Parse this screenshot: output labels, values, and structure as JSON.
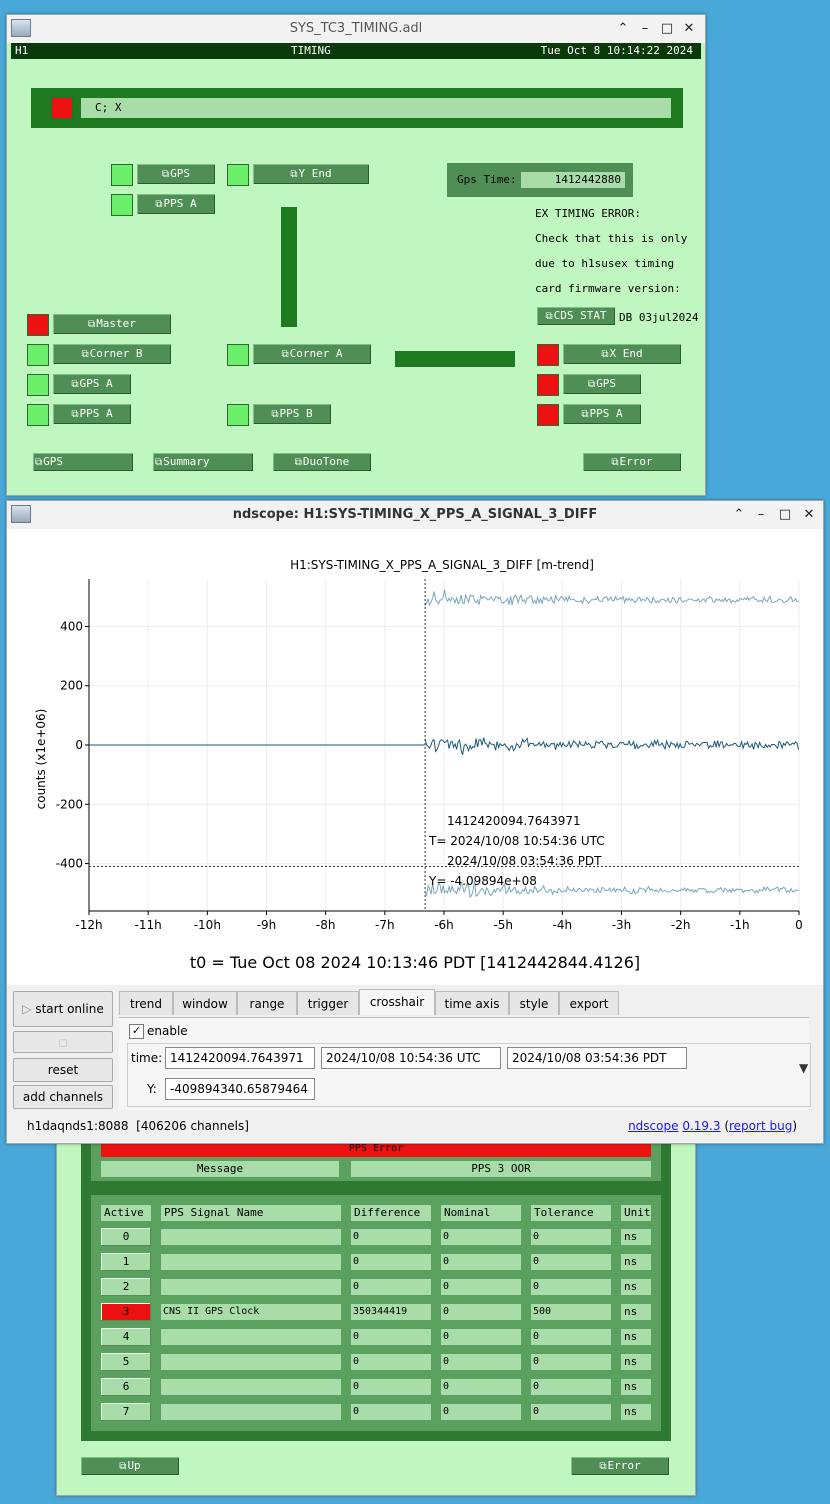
{
  "medm": {
    "window_title": "SYS_TC3_TIMING.adl",
    "header": {
      "site": "H1",
      "title": "TIMING",
      "datetime": "Tue Oct  8 10:14:22 2024"
    },
    "status_text": "C; X",
    "buttons": {
      "gps_top": "GPS",
      "pps_a_top": "PPS A",
      "y_end": "Y End",
      "master": "Master",
      "corner_b": "Corner B",
      "gps_a": "GPS A",
      "pps_a_left": "PPS A",
      "corner_a": "Corner A",
      "pps_b": "PPS B",
      "x_end": "X End",
      "gps_right": "GPS",
      "pps_a_right": "PPS A",
      "cds_stat": "CDS STAT",
      "gps_bottom": "GPS",
      "summary": "Summary",
      "duotone": "DuoTone",
      "error": "Error"
    },
    "gps_time_label": "Gps Time:",
    "gps_time_value": "1412442880",
    "message_lines": [
      "EX TIMING ERROR:",
      "Check that this is only",
      "due to h1susex timing",
      "card firmware version:"
    ],
    "db_label": "DB 03jul2024"
  },
  "ndscope": {
    "window_title": "ndscope: H1:SYS-TIMING_X_PPS_A_SIGNAL_3_DIFF",
    "plot_title": "H1:SYS-TIMING_X_PPS_A_SIGNAL_3_DIFF [m-trend]",
    "t0_label": "t0 = Tue Oct 08 2024 10:13:46 PDT [1412442844.4126]",
    "buttons": {
      "start_online": "start online",
      "reset": "reset",
      "add_channels": "add channels"
    },
    "tabs": [
      "trend",
      "window",
      "range",
      "trigger",
      "crosshair",
      "time axis",
      "style",
      "export"
    ],
    "selected_tab": "crosshair",
    "crosshair": {
      "enable_label": "enable",
      "enabled": true,
      "time_label": "time:",
      "time_gps": "1412420094.7643971",
      "time_utc": "2024/10/08 10:54:36 UTC",
      "time_pdt": "2024/10/08 03:54:36 PDT",
      "y_label": "Y:",
      "y_value": "-409894340.65879464"
    },
    "annotation": {
      "gps": "1412420094.7643971",
      "utc": "T= 2024/10/08 10:54:36 UTC",
      "pdt": "2024/10/08 03:54:36 PDT",
      "y": "Y= -4.09894e+08"
    },
    "status_left": "h1daqnds1:8088  [406206 channels]",
    "status_right_prefix": "ndscope",
    "version": "0.19.3",
    "report_bug": "report bug"
  },
  "chart_data": {
    "type": "line",
    "title": "H1:SYS-TIMING_X_PPS_A_SIGNAL_3_DIFF [m-trend]",
    "xlabel": "",
    "ylabel": "counts (x1e+06)",
    "x_ticks": [
      "-12h",
      "-11h",
      "-10h",
      "-9h",
      "-8h",
      "-7h",
      "-6h",
      "-5h",
      "-4h",
      "-3h",
      "-2h",
      "-1h",
      "0"
    ],
    "y_ticks": [
      400,
      200,
      0,
      -200,
      -400
    ],
    "xlim_hours": [
      -12,
      0
    ],
    "ylim": [
      -560,
      560
    ],
    "crosshair": {
      "x_hours": -6.32,
      "y": -409.894
    },
    "series": [
      {
        "values_desc": "mean",
        "x_hours": [
          -12,
          -6.32,
          -6.32,
          0
        ],
        "y": [
          0,
          0,
          0,
          0
        ]
      },
      {
        "values_desc": "max",
        "x_hours": [
          -6.32,
          0
        ],
        "y": [
          490,
          490
        ]
      },
      {
        "values_desc": "min",
        "x_hours": [
          -6.32,
          0
        ],
        "y": [
          -490,
          -490
        ]
      }
    ],
    "grid": true
  },
  "pps_panel": {
    "error_title": "PPS Error",
    "message_label": "Message",
    "message_value": "PPS 3 OOR",
    "headers": [
      "Active",
      "PPS Signal Name",
      "Difference",
      "Nominal",
      "Tolerance",
      "Unit"
    ],
    "rows": [
      {
        "active": "0",
        "name": "",
        "difference": "0",
        "nominal": "0",
        "tolerance": "0",
        "unit": "ns",
        "alarm": false
      },
      {
        "active": "1",
        "name": "",
        "difference": "0",
        "nominal": "0",
        "tolerance": "0",
        "unit": "ns",
        "alarm": false
      },
      {
        "active": "2",
        "name": "",
        "difference": "0",
        "nominal": "0",
        "tolerance": "0",
        "unit": "ns",
        "alarm": false
      },
      {
        "active": "3",
        "name": "CNS II GPS Clock",
        "difference": "350344419",
        "nominal": "0",
        "tolerance": "500",
        "unit": "ns",
        "alarm": true
      },
      {
        "active": "4",
        "name": "",
        "difference": "0",
        "nominal": "0",
        "tolerance": "0",
        "unit": "ns",
        "alarm": false
      },
      {
        "active": "5",
        "name": "",
        "difference": "0",
        "nominal": "0",
        "tolerance": "0",
        "unit": "ns",
        "alarm": false
      },
      {
        "active": "6",
        "name": "",
        "difference": "0",
        "nominal": "0",
        "tolerance": "0",
        "unit": "ns",
        "alarm": false
      },
      {
        "active": "7",
        "name": "",
        "difference": "0",
        "nominal": "0",
        "tolerance": "0",
        "unit": "ns",
        "alarm": false
      }
    ],
    "up_button": "Up",
    "error_button": "Error"
  }
}
